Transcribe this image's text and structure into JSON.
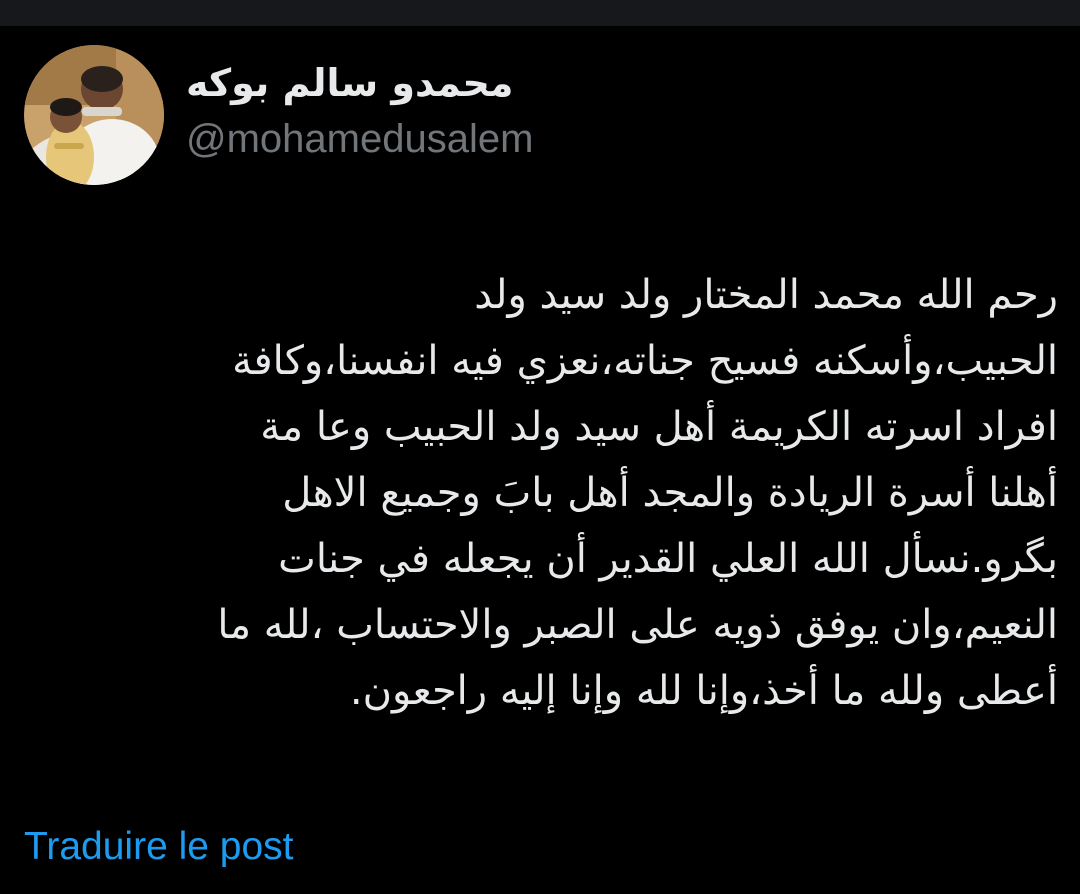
{
  "colors": {
    "background": "#000000",
    "text_primary": "#e7e9ea",
    "text_secondary": "#71767b",
    "link": "#1d9bf0"
  },
  "author": {
    "display_name": "محمدو سالم بوكه",
    "handle": "@mohamedusalem",
    "avatar_icon": "profile-photo"
  },
  "post": {
    "lines": [
      "رحم الله محمد المختار ولد سيد ولد",
      "الحبيب،وأسكنه فسيح جناته،نعزي فيه انفسنا،وكافة",
      "افراد اسرته الكريمة أهل سيد ولد الحبيب وعا مة",
      "أهلنا أسرة الريادة والمجد أهل بابَ وجميع الاهل",
      "بگرو.نسأل الله العلي القدير أن يجعله في جنات",
      "النعيم،وان يوفق ذويه على الصبر والاحتساب ،لله ما",
      "أعطى ولله ما أخذ،وإنا لله وإنا إليه راجعون."
    ]
  },
  "actions": {
    "translate_label": "Traduire le post"
  }
}
